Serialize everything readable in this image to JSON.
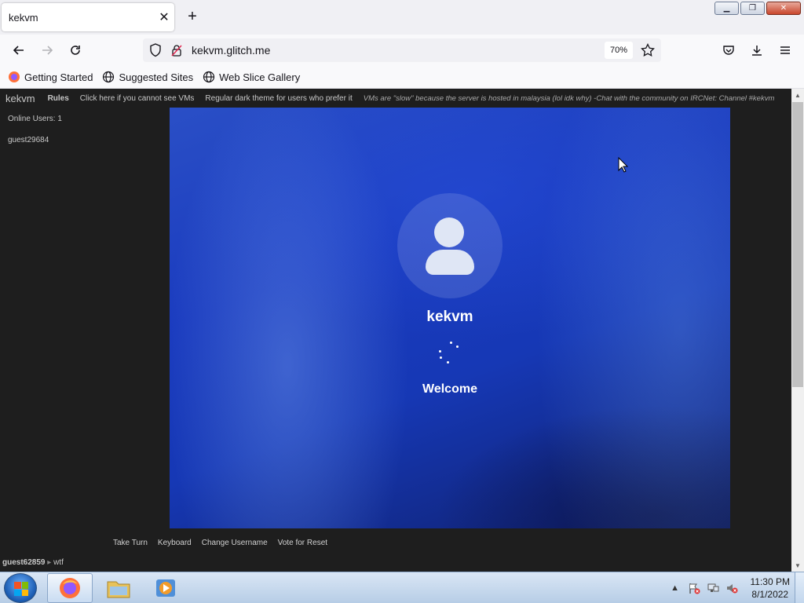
{
  "browser": {
    "tab_title": "kekvm",
    "url": "kekvm.glitch.me",
    "zoom": "70%",
    "bookmarks": [
      "Getting Started",
      "Suggested Sites",
      "Web Slice Gallery"
    ]
  },
  "page": {
    "brand": "kekvm",
    "nav": {
      "rules": "Rules",
      "cannot_see": "Click here if you cannot see VMs",
      "dark_theme": "Regular dark theme for users who prefer it",
      "notice": "VMs are \"slow\" because the server is hosted in malaysia (lol idk why) -Chat with the community on IRCNet: Channel #kekvm"
    },
    "online_users": "Online Users: 1",
    "users": [
      "guest29684"
    ],
    "vm": {
      "username": "kekvm",
      "status": "Welcome"
    },
    "controls": {
      "take_turn": "Take Turn",
      "keyboard": "Keyboard",
      "change_username": "Change Username",
      "vote_reset": "Vote for Reset"
    },
    "chat": {
      "name": "guest62859",
      "separator": "▸",
      "message": "wtf"
    }
  },
  "taskbar": {
    "time": "11:30 PM",
    "date": "8/1/2022"
  },
  "colors": {
    "page_bg": "#1e1e1e",
    "vm_blue": "#1a3bbf",
    "firefox_orange": "#ff7139"
  }
}
